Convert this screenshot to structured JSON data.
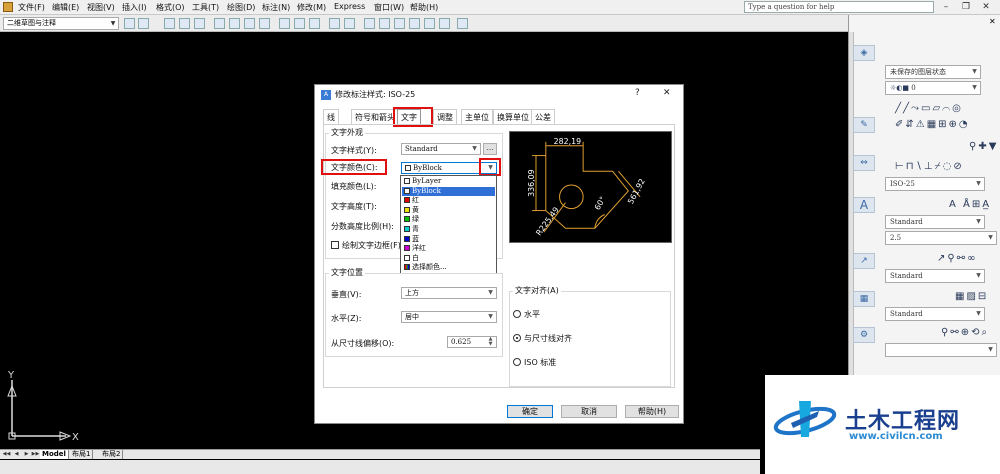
{
  "menu": [
    "文件(F)",
    "编辑(E)",
    "视图(V)",
    "插入(I)",
    "格式(O)",
    "工具(T)",
    "绘图(D)",
    "标注(N)",
    "修改(M)",
    "Express",
    "窗口(W)",
    "帮助(H)"
  ],
  "help_placeholder": "Type a question for help",
  "workspace": "二维草图与注释",
  "palette": {
    "layer_state": "未保存的图层状态",
    "layer_current": "0",
    "dim_style": "ISO-25",
    "text_style": "Standard",
    "text_height": "2.5",
    "table_style": "Standard",
    "mleader_style": "Standard"
  },
  "layout_tabs": [
    "Model",
    "布局1",
    "布局2"
  ],
  "ucs": {
    "x": "X",
    "y": "Y"
  },
  "watermark": {
    "name": "土木工程网",
    "url": "www.civilcn.com"
  },
  "dialog": {
    "title": "修改标注样式: ISO-25",
    "help_btn": "?",
    "close_btn": "✕",
    "tabs": [
      "线",
      "符号和箭头",
      "文字",
      "调整",
      "主单位",
      "换算单位",
      "公差"
    ],
    "active_tab": "文字",
    "appearance": {
      "group_label": "文字外观",
      "text_style_label": "文字样式(Y):",
      "text_style_value": "Standard",
      "text_style_btn": "...",
      "text_color_label": "文字颜色(C):",
      "text_color_value": "ByBlock",
      "fill_color_label": "填充颜色(L):",
      "text_height_label": "文字高度(T):",
      "fraction_label": "分数高度比例(H):",
      "frame_label": "绘制文字边框(F)"
    },
    "color_options": [
      {
        "label": "ByLayer",
        "color": "#ffffff"
      },
      {
        "label": "ByBlock",
        "color": "#ffffff"
      },
      {
        "label": "红",
        "color": "#e00000"
      },
      {
        "label": "黄",
        "color": "#f0e000"
      },
      {
        "label": "绿",
        "color": "#00c000"
      },
      {
        "label": "青",
        "color": "#00d0d0"
      },
      {
        "label": "蓝",
        "color": "#0000d0"
      },
      {
        "label": "洋红",
        "color": "#d000d0"
      },
      {
        "label": "白",
        "color": "#ffffff"
      },
      {
        "label": "选择颜色...",
        "color": "multicolor"
      }
    ],
    "selected_color": "ByBlock",
    "placement": {
      "group_label": "文字位置",
      "vertical_label": "垂直(V):",
      "vertical_value": "上方",
      "horizontal_label": "水平(Z):",
      "horizontal_value": "居中",
      "offset_label": "从尺寸线偏移(O):",
      "offset_value": "0.625"
    },
    "alignment": {
      "group_label": "文字对齐(A)",
      "options": [
        "水平",
        "与尺寸线对齐",
        "ISO 标准"
      ],
      "selected": "与尺寸线对齐"
    },
    "preview": {
      "d1": "282,19",
      "d2": "336,09",
      "d3": "R225,49",
      "d4": "561,92",
      "d5": "60°"
    },
    "buttons": {
      "ok": "确定",
      "cancel": "取消",
      "help": "帮助(H)"
    }
  }
}
